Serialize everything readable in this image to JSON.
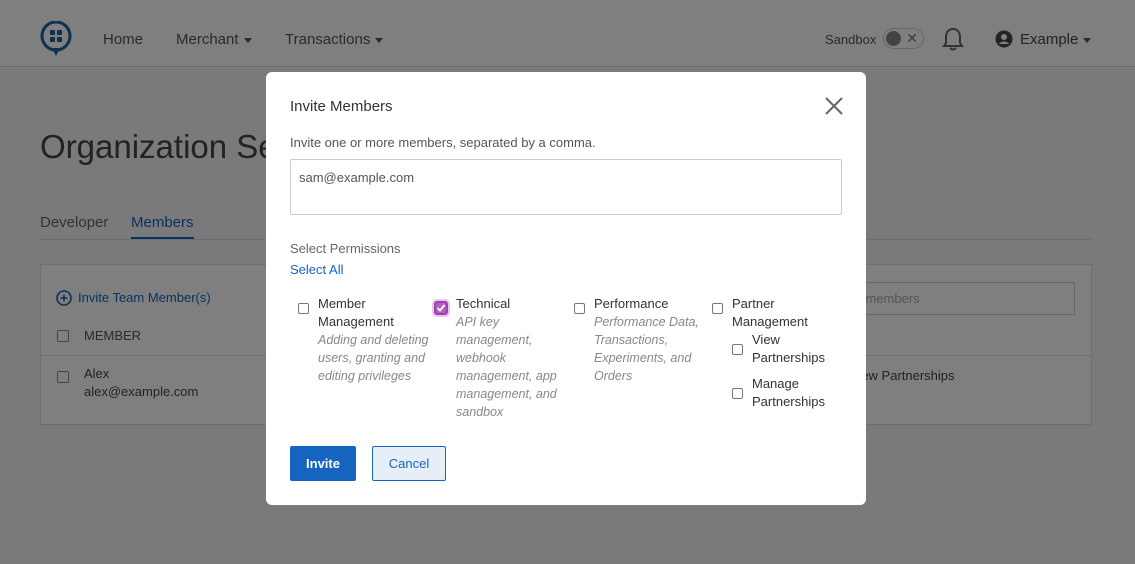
{
  "nav": {
    "home": "Home",
    "merchant": "Merchant",
    "transactions": "Transactions",
    "sandbox_label": "Sandbox",
    "user_name": "Example"
  },
  "page": {
    "title": "Organization Settings",
    "tabs": [
      {
        "label": "Developer",
        "active": false
      },
      {
        "label": "Members",
        "active": true
      }
    ],
    "invite_link": "Invite Team Member(s)",
    "member_header": "MEMBER",
    "filter_placeholder": "Filter members",
    "members": [
      {
        "name": "Alex",
        "email": "alex@example.com",
        "permissions": "View Partnerships"
      }
    ]
  },
  "modal": {
    "title": "Invite Members",
    "description": "Invite one or more members, separated by a comma.",
    "emails_value": "sam@example.com",
    "permissions_heading": "Select Permissions",
    "select_all": "Select All",
    "permissions": [
      {
        "title_l1": "Member",
        "title_l2": "Management",
        "desc": [
          "Adding and deleting",
          "users, granting and",
          "editing privileges"
        ],
        "checked": false
      },
      {
        "title_l1": "Technical",
        "title_l2": "",
        "desc": [
          "API key",
          "management,",
          "webhook",
          "management, app",
          "management, and",
          "sandbox"
        ],
        "checked": true
      },
      {
        "title_l1": "Performance",
        "title_l2": "",
        "desc": [
          "Performance Data,",
          "Transactions,",
          "Experiments, and",
          "Orders"
        ],
        "checked": false
      },
      {
        "title_l1": "Partner",
        "title_l2": "Management",
        "checked": false,
        "sub": [
          {
            "l1": "View",
            "l2": "Partnerships",
            "checked": false
          },
          {
            "l1": "Manage",
            "l2": "Partnerships",
            "checked": false
          }
        ]
      }
    ],
    "invite_label": "Invite",
    "cancel_label": "Cancel"
  },
  "colors": {
    "accent": "#1565c0",
    "checked": "#b060c0"
  }
}
